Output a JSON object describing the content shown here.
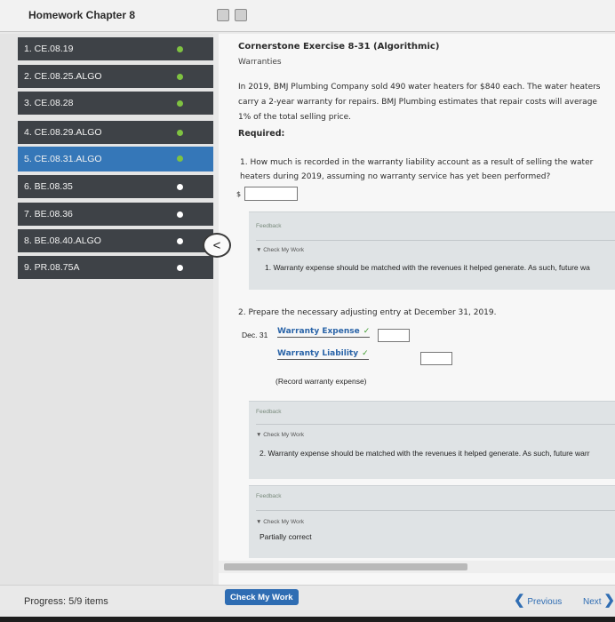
{
  "header": {
    "title": "Homework Chapter 8"
  },
  "sidebar": {
    "items": [
      {
        "label": "1. CE.08.19",
        "status": "complete"
      },
      {
        "label": "2. CE.08.25.ALGO",
        "status": "complete"
      },
      {
        "label": "3. CE.08.28",
        "status": "complete"
      },
      {
        "label": "4. CE.08.29.ALGO",
        "status": "complete"
      },
      {
        "label": "5. CE.08.31.ALGO",
        "status": "current"
      },
      {
        "label": "6. BE.08.35",
        "status": "incomplete"
      },
      {
        "label": "7. BE.08.36",
        "status": "incomplete"
      },
      {
        "label": "8. BE.08.40.ALGO",
        "status": "incomplete"
      },
      {
        "label": "9. PR.08.75A",
        "status": "incomplete"
      }
    ],
    "collapse_glyph": "<"
  },
  "exercise": {
    "title": "Cornerstone Exercise 8-31 (Algorithmic)",
    "subtitle": "Warranties",
    "body": "In 2019, BMJ Plumbing Company sold 490 water heaters for $840 each. The water heaters carry a 2-year warranty for repairs. BMJ Plumbing estimates that repair costs will average 1% of the total selling price.",
    "required": "Required:",
    "q1": {
      "text": "1. How much is recorded in the warranty liability account as a result of selling the water heaters during 2019, assuming no warranty service has yet been performed?",
      "currency": "$",
      "answer": ""
    },
    "feedback1": {
      "label": "Feedback",
      "check": "▼ Check My Work",
      "text": "1. Warranty expense should be matched with the revenues it helped generate. As such, future wa"
    },
    "q2": {
      "text": "2. Prepare the necessary adjusting entry at December 31, 2019.",
      "date": "Dec. 31",
      "debit_account": "Warranty Expense",
      "credit_account": "Warranty Liability",
      "check_glyph": "✓",
      "debit_amount": "",
      "credit_amount": "",
      "memo": "(Record warranty expense)"
    },
    "feedback2": {
      "label": "Feedback",
      "check": "▼ Check My Work",
      "text": "2. Warranty expense should be matched with the revenues it helped generate. As such, future warr"
    },
    "feedback3": {
      "label": "Feedback",
      "check": "▼ Check My Work",
      "text": "Partially correct"
    }
  },
  "footer": {
    "progress": "Progress: 5/9 items",
    "check_button": "Check My Work",
    "prev_label": "Previous",
    "next_label": "Next",
    "prev_glyph": "❮",
    "next_glyph": "❯"
  },
  "colors": {
    "accent": "#3577b8",
    "complete": "#7fc241",
    "sidebar": "#3e4247"
  }
}
